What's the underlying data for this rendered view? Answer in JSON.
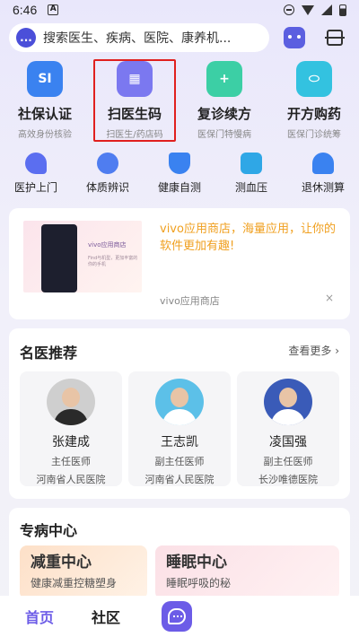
{
  "status_bar": {
    "time": "6:46",
    "a_label": "A",
    "icons": [
      "dnd-icon",
      "wifi-icon",
      "signal-icon",
      "battery-icon"
    ]
  },
  "search": {
    "placeholder": "搜索医生、疾病、医院、康养机...",
    "logo_text": "..."
  },
  "quick_actions": [
    {
      "title": "社保认证",
      "subtitle": "高效身份核验",
      "icon": "si-icon",
      "icon_text": "SI",
      "color": "#3a82f0"
    },
    {
      "title": "扫医生码",
      "subtitle": "扫医生/药店码",
      "icon": "qr-code-icon",
      "icon_text": "▦",
      "color": "#7b78f0",
      "highlighted": true
    },
    {
      "title": "复诊续方",
      "subtitle": "医保门特慢病",
      "icon": "chat-plus-icon",
      "icon_text": "+",
      "color": "#3ccfa5"
    },
    {
      "title": "开方购药",
      "subtitle": "医保门诊统筹",
      "icon": "capsule-icon",
      "icon_text": "⬭",
      "color": "#33c2e0"
    }
  ],
  "services": [
    {
      "label": "医护上门",
      "icon": "heart-home-icon"
    },
    {
      "label": "体质辨识",
      "icon": "meditation-icon"
    },
    {
      "label": "健康自测",
      "icon": "shield-pulse-icon"
    },
    {
      "label": "测血压",
      "icon": "monitor-icon"
    },
    {
      "label": "退休测算",
      "icon": "person-calc-icon"
    }
  ],
  "ad": {
    "text": "vivo应用商店，海量应用，让你的软件更加有趣!",
    "source": "vivo应用商店",
    "mini_title": "vivo应用商店",
    "mini_text": "Find与机型，更加丰富的你的手机",
    "close": "×"
  },
  "doctors": {
    "title": "名医推荐",
    "more": "查看更多 ›",
    "items": [
      {
        "name": "张建成",
        "title": "主任医师",
        "hospital": "河南省人民医院"
      },
      {
        "name": "王志凯",
        "title": "副主任医师",
        "hospital": "河南省人民医院"
      },
      {
        "name": "凌国强",
        "title": "副主任医师",
        "hospital": "长沙唯德医院"
      }
    ]
  },
  "specialty": {
    "title": "专病中心",
    "items": [
      {
        "name": "减重中心",
        "desc": "健康减重控糖塑身"
      },
      {
        "name": "睡眠中心",
        "desc": "睡眠呼吸的秘"
      }
    ]
  },
  "tabs": {
    "home": "首页",
    "community": "社区"
  },
  "colors": {
    "accent": "#6c5ce7",
    "highlight_border": "#e0201e",
    "ad_text": "#f0a020"
  }
}
